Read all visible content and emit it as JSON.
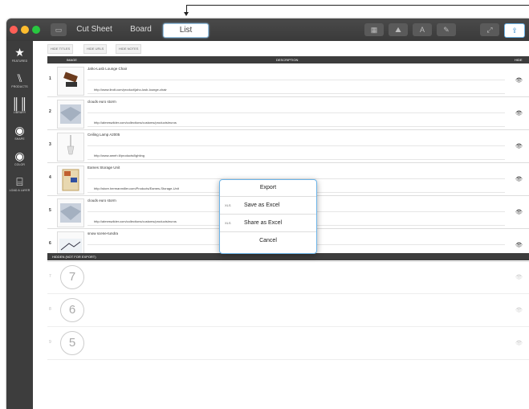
{
  "toolbar": {
    "tabs": [
      {
        "label": "Cut Sheet"
      },
      {
        "label": "Board"
      },
      {
        "label": "List"
      }
    ]
  },
  "sidebar": {
    "items": [
      {
        "label": "FEATURED",
        "icon": "star-icon"
      },
      {
        "label": "PRODUCTS",
        "icon": "chair-icon"
      },
      {
        "label": "LIBRARY",
        "icon": "library-icon"
      },
      {
        "label": "SHAPE",
        "icon": "shape-icon"
      },
      {
        "label": "COLOR",
        "icon": "color-icon"
      },
      {
        "label": "LOAD A LAYER",
        "icon": "layer-icon"
      }
    ]
  },
  "view_buttons": [
    {
      "label": "HIDE TITLES"
    },
    {
      "label": "HIDE URLS"
    },
    {
      "label": "HIDE NOTES"
    }
  ],
  "table": {
    "headers": {
      "image": "IMAGE",
      "description": "DESCRIPTION",
      "hide": "HIDE"
    },
    "rows": [
      {
        "num": "1",
        "title": "Jaho-Lusb Lounge Chair",
        "url": "http://www.lindt.com/product/jaho-lusb-lounge-chair"
      },
      {
        "num": "2",
        "title": "clouds euro storm",
        "url": "http://almeswilder.com/collections/customs/products/euros"
      },
      {
        "num": "3",
        "title": "Ceiling Lamp A2005",
        "url": "http://www.ameh.fi/products/lighting"
      },
      {
        "num": "4",
        "title": "Eames Storage Unit",
        "url": "http://store.hermanmiller.com/Products/Eames-Storage-Unit"
      },
      {
        "num": "5",
        "title": "clouds euro storm",
        "url": "http://almeswilder.com/collections/customs/products/euros"
      },
      {
        "num": "6",
        "title": "snow scene-tundra",
        "url": "http://almeswilder.com/collections/wallpapers/products/snow-scene"
      }
    ],
    "hidden_header": "HIDDEN (NOT FOR EXPORT)",
    "hidden_rows": [
      {
        "num": "7",
        "circle": "7"
      },
      {
        "num": "8",
        "circle": "6"
      },
      {
        "num": "9",
        "circle": "5"
      }
    ]
  },
  "export_popup": {
    "title": "Export",
    "items": [
      {
        "tag": "XLS",
        "label": "Save as Excel"
      },
      {
        "tag": "XLS",
        "label": "Share as Excel"
      }
    ],
    "cancel": "Cancel"
  },
  "colors": {
    "titlebar": "#3d3d3d",
    "accent": "#6cb4e8",
    "close": "#ff5f57",
    "minimize": "#ffbd2e",
    "zoom": "#28c840"
  }
}
